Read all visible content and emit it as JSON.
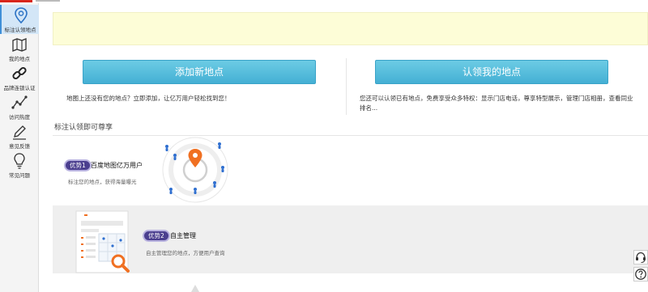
{
  "sidebar": {
    "items": [
      {
        "label": "标注认领地点",
        "icon": "map-pin-icon"
      },
      {
        "label": "我的地点",
        "icon": "map-icon"
      },
      {
        "label": "品牌连锁认证",
        "icon": "link-icon"
      },
      {
        "label": "访问热度",
        "icon": "line-chart-icon"
      },
      {
        "label": "意见反馈",
        "icon": "pencil-icon"
      },
      {
        "label": "常见问题",
        "icon": "lightbulb-icon"
      }
    ],
    "active_index": 0
  },
  "actions": {
    "add_label": "添加新地点",
    "add_desc": "地图上还没有您的地点？立即添加，让亿万用户轻松找到您！",
    "claim_label": "认领我的地点",
    "claim_desc": "您还可以认领已有地点，免费享受众多特权：显示门店电话，尊享特型展示，管理门店相册，查看同业排名..."
  },
  "section": {
    "title": "标注认领即可尊享"
  },
  "advantages": [
    {
      "badge": "优势1",
      "title": "百度地图亿万用户",
      "desc": "标注您的地点，获得海量曝光"
    },
    {
      "badge": "优势2",
      "title": "自主管理",
      "desc": "自主管理您的地点，方便用户查询"
    }
  ],
  "colors": {
    "button_top": "#6ccbe4",
    "button_bottom": "#44b0d4",
    "notice_bg": "#fdfdd7",
    "badge": "#4b3f8f",
    "pin": "#f07022",
    "user_icon": "#2f6fd0",
    "active_side": "#d3e6f7"
  }
}
